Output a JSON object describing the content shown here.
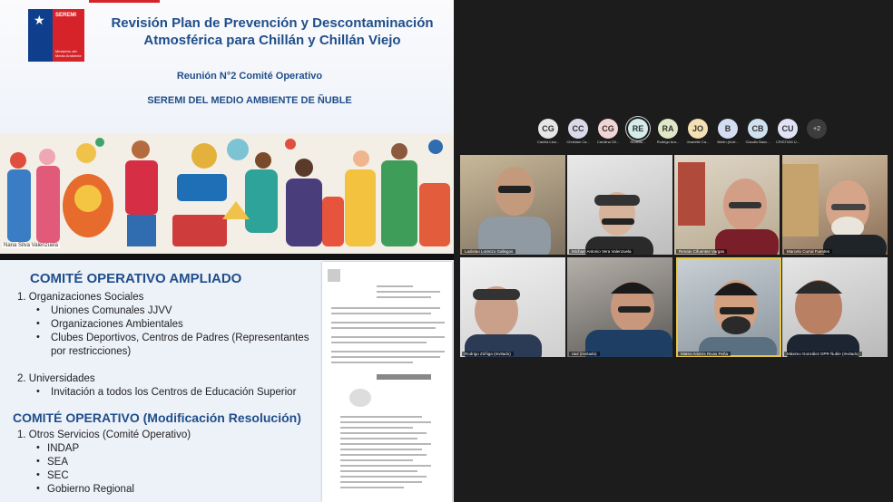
{
  "slide1": {
    "title": "Revisión Plan de Prevención y Descontaminación Atmosférica para Chillán y Chillán Viejo",
    "meeting": "Reunión N°2 Comité Operativo",
    "office": "SEREMI DEL MEDIO AMBIENTE DE ÑUBLE",
    "logo_top": "SEREMI",
    "logo_region": "Región de Ñuble",
    "logo_ministry": "Ministerio del Medio Ambiente",
    "caption": "Nana Silva Valenzuela"
  },
  "slide2": {
    "heading1": "COMITÉ OPERATIVO AMPLIADO",
    "item1": "1.  Organizaciones Sociales",
    "item1_bullets": [
      "Uniones Comunales JJVV",
      "Organizaciones Ambientales",
      "Clubes Deportivos, Centros de Padres (Representantes",
      "por restricciones)"
    ],
    "item2": "2.  Universidades",
    "item2_bullet": "Invitación a todos los Centros de Educación Superior",
    "heading2": "COMITÉ OPERATIVO (Modificación Resolución)",
    "item3": "1.  Otros Servicios (Comité Operativo)",
    "item3_bullets": [
      "INDAP",
      "SEA",
      "SEC",
      "Gobierno Regional"
    ]
  },
  "participants_bar": {
    "avatars": [
      {
        "initials": "CG",
        "name": "Camila Lisa...",
        "color": "#e6e6e6"
      },
      {
        "initials": "CC",
        "name": "Christian Ca...",
        "color": "#d9d9ea"
      },
      {
        "initials": "CG",
        "name": "Carolina Gil...",
        "color": "#f2d4d4"
      },
      {
        "initials": "RE",
        "name": "Ricardo...",
        "color": "#d4ecea"
      },
      {
        "initials": "RA",
        "name": "Rodrigo Ara...",
        "color": "#dfe8c6"
      },
      {
        "initials": "JO",
        "name": "Jeanette Ca...",
        "color": "#f4e0b2"
      },
      {
        "initials": "B",
        "name": "Belén (Invit...",
        "color": "#d3def2"
      },
      {
        "initials": "CB",
        "name": "Claudio Basc...",
        "color": "#cfe0ef"
      },
      {
        "initials": "CU",
        "name": "CRISTIAN U...",
        "color": "#e0e3f5"
      }
    ],
    "more_label": "+2"
  },
  "videos": [
    {
      "name": "Ladislao Lorenzo Gallegos"
    },
    {
      "name": "Michael Antonio Vera Valenzuela"
    },
    {
      "name": "Renato Cifuentes Vargas"
    },
    {
      "name": "Marcelo Curral Fuentes"
    },
    {
      "name": "Rodrigo Zúñiga (Invitado)"
    },
    {
      "name": "raul (Invitado)"
    },
    {
      "name": "Mateo Andrés Rivas Peña"
    },
    {
      "name": "Máximo González DPR Ñuble (Invitado)"
    }
  ]
}
